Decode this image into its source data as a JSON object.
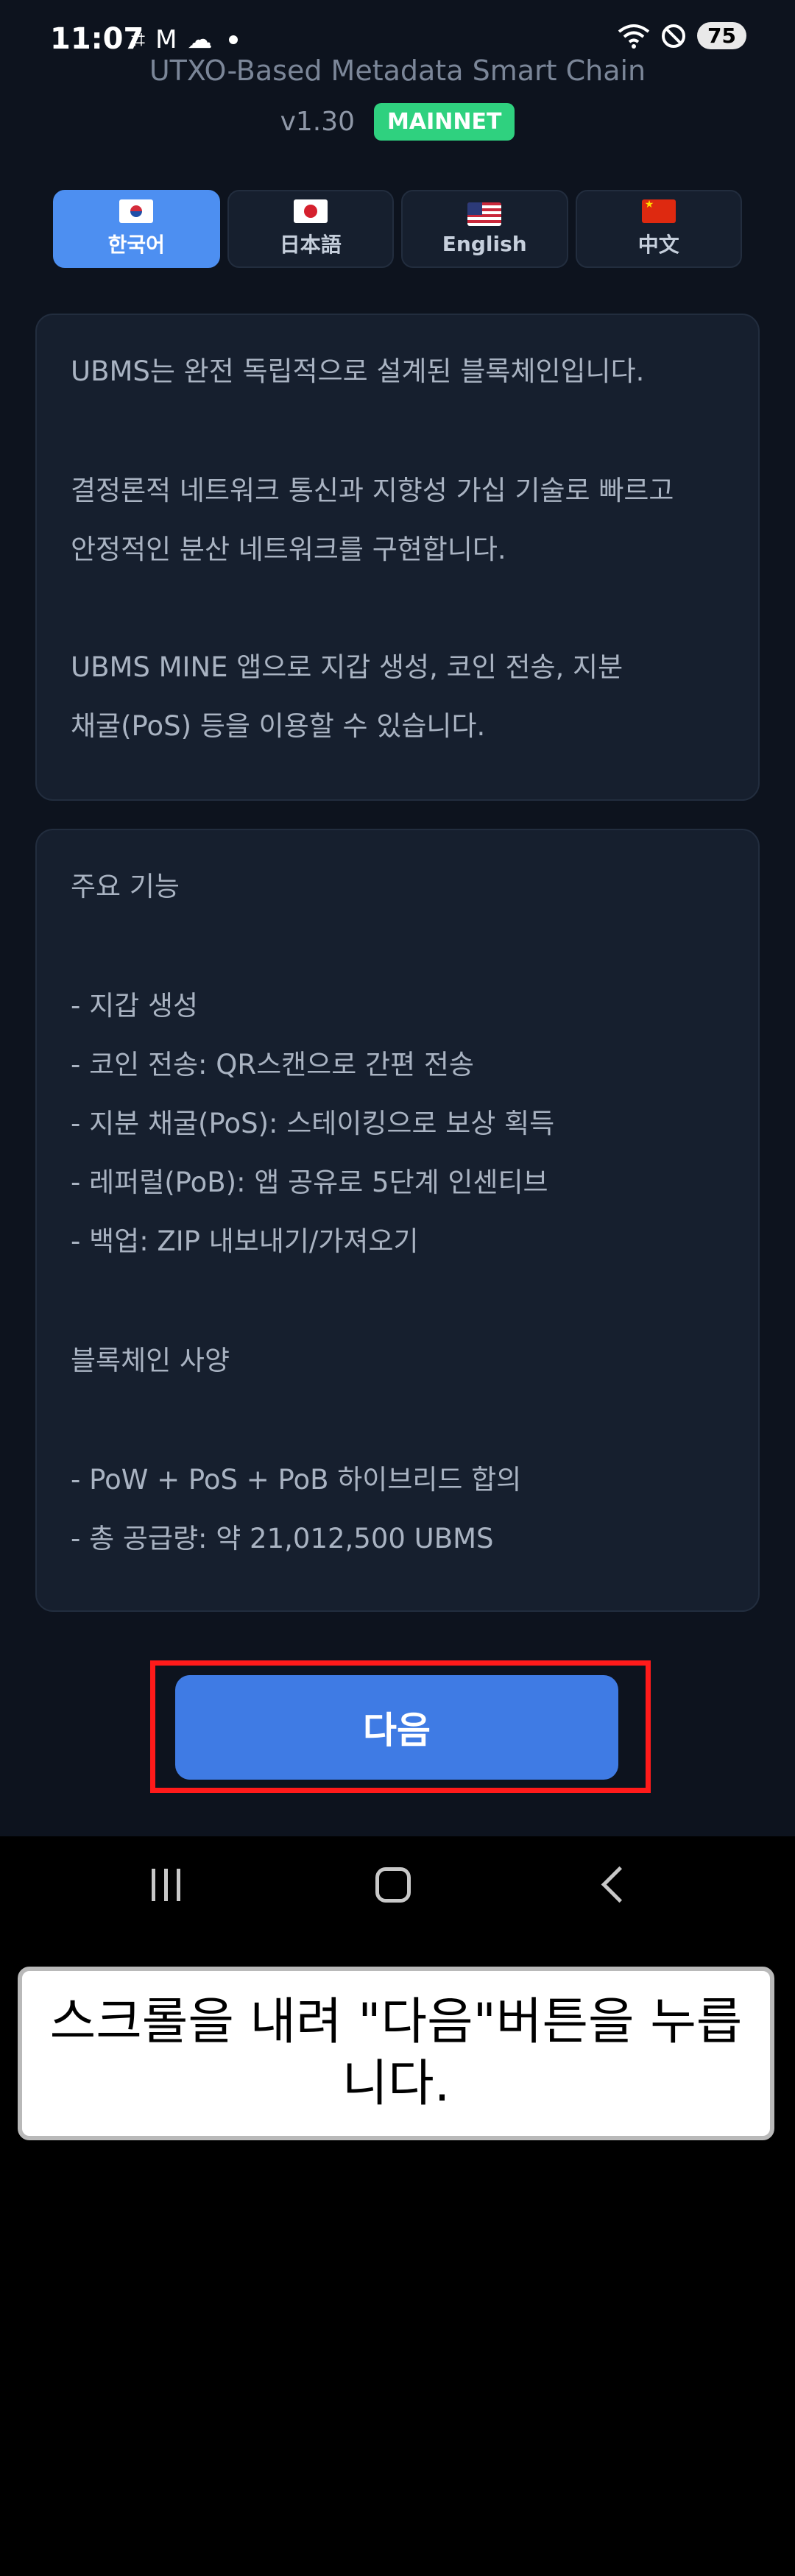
{
  "status_bar": {
    "time": "11:07",
    "icons_left": [
      "screenshot-icon",
      "gmail-icon",
      "cloud-icon",
      "dot-icon"
    ],
    "icons_right": [
      "wifi-icon",
      "do-not-disturb-icon"
    ],
    "battery": "75"
  },
  "header": {
    "subtitle": "UTXO-Based Metadata Smart Chain",
    "version": "v1.30",
    "network_badge": "MAINNET",
    "badge_color": "#2fd17f"
  },
  "languages": [
    {
      "label": "한국어",
      "flag": "kr-flag-icon",
      "active": true
    },
    {
      "label": "日本語",
      "flag": "jp-flag-icon",
      "active": false
    },
    {
      "label": "English",
      "flag": "us-flag-icon",
      "active": false
    },
    {
      "label": "中文",
      "flag": "cn-flag-icon",
      "active": false
    }
  ],
  "intro": {
    "lines": [
      "UBMS는 완전 독립적으로 설계된 블록체인입니다.",
      "결정론적 네트워크 통신과 지향성 가십 기술로 빠르고",
      "안정적인 분산 네트워크를 구현합니다.",
      "UBMS MINE 앱으로 지갑 생성, 코인 전송, 지분",
      "채굴(PoS) 등을 이용할 수 있습니다."
    ]
  },
  "features": {
    "title": "주요 기능",
    "items": [
      "- 지갑 생성",
      "- 코인 전송: QR스캔으로 간편 전송",
      "- 지분 채굴(PoS): 스테이킹으로 보상 획득",
      "- 레퍼럴(PoB): 앱 공유로 5단계 인센티브",
      "- 백업: ZIP 내보내기/가져오기"
    ],
    "spec_title": "블록체인 사양",
    "spec_items": [
      "- PoW + PoS + PoB 하이브리드 합의",
      "- 총 공급량: 약 21,012,500 UBMS"
    ]
  },
  "next_button": {
    "label": "다음",
    "color": "#3f7be4"
  },
  "caption": {
    "text": "스크롤을 내려 \"다음\"버튼을 누릅니다."
  },
  "colors": {
    "background": "#0d131e",
    "card": "#161f2e",
    "active_tab": "#4d8ff1",
    "highlight": "#ff1a1a"
  }
}
